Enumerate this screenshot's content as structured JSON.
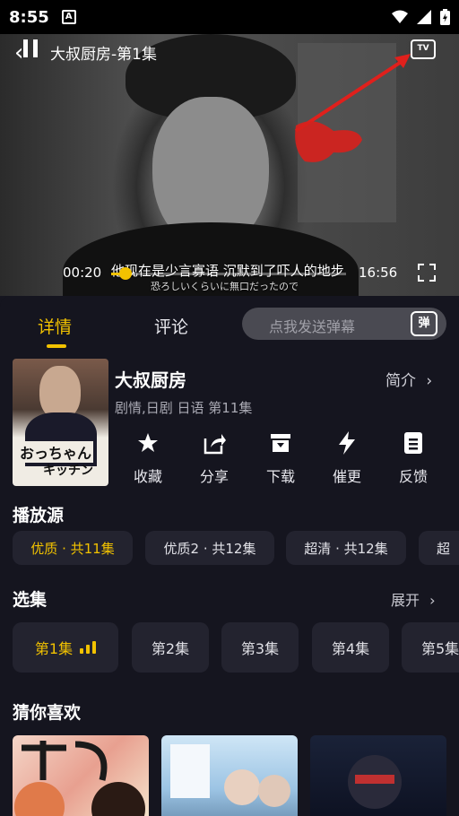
{
  "status_bar": {
    "time": "8:55",
    "notif": "A"
  },
  "player": {
    "title": "大叔厨房-第1集",
    "cast_badge": "TV",
    "current_time": "00:20",
    "duration": "16:56",
    "progress": 0.06,
    "subtitle": "他现在是少言寡语 沉默到了吓人的地步",
    "subtitle_jp": "恐ろしいくらいに無口だったので"
  },
  "tabs": [
    {
      "label": "详情",
      "active": true
    },
    {
      "label": "评论",
      "active": false
    }
  ],
  "danmu": {
    "placeholder": "点我发送弹幕",
    "button": "弹"
  },
  "show": {
    "poster_text_1": "おっちゃん",
    "poster_text_2": "キッチン",
    "title": "大叔厨房",
    "intro_label": "简介",
    "meta": "剧情,日剧 日语 第11集"
  },
  "actions": [
    {
      "label": "收藏",
      "icon": "star-icon"
    },
    {
      "label": "分享",
      "icon": "share-icon"
    },
    {
      "label": "下载",
      "icon": "download-icon"
    },
    {
      "label": "催更",
      "icon": "lightning-icon"
    },
    {
      "label": "反馈",
      "icon": "feedback-icon"
    }
  ],
  "sources": {
    "title": "播放源",
    "items": [
      {
        "label": "优质 · 共11集",
        "active": true
      },
      {
        "label": "优质2 · 共12集",
        "active": false
      },
      {
        "label": "超清 · 共12集",
        "active": false
      },
      {
        "label": "超",
        "active": false
      }
    ]
  },
  "episodes": {
    "title": "选集",
    "expand_label": "展开",
    "items": [
      {
        "label": "第1集",
        "active": true
      },
      {
        "label": "第2集",
        "active": false
      },
      {
        "label": "第3集",
        "active": false
      },
      {
        "label": "第4集",
        "active": false
      },
      {
        "label": "第5集",
        "active": false
      }
    ]
  },
  "recommend": {
    "title": "猜你喜欢"
  },
  "colors": {
    "accent": "#f2c200",
    "background": "#15151f",
    "chip": "#23232f"
  }
}
